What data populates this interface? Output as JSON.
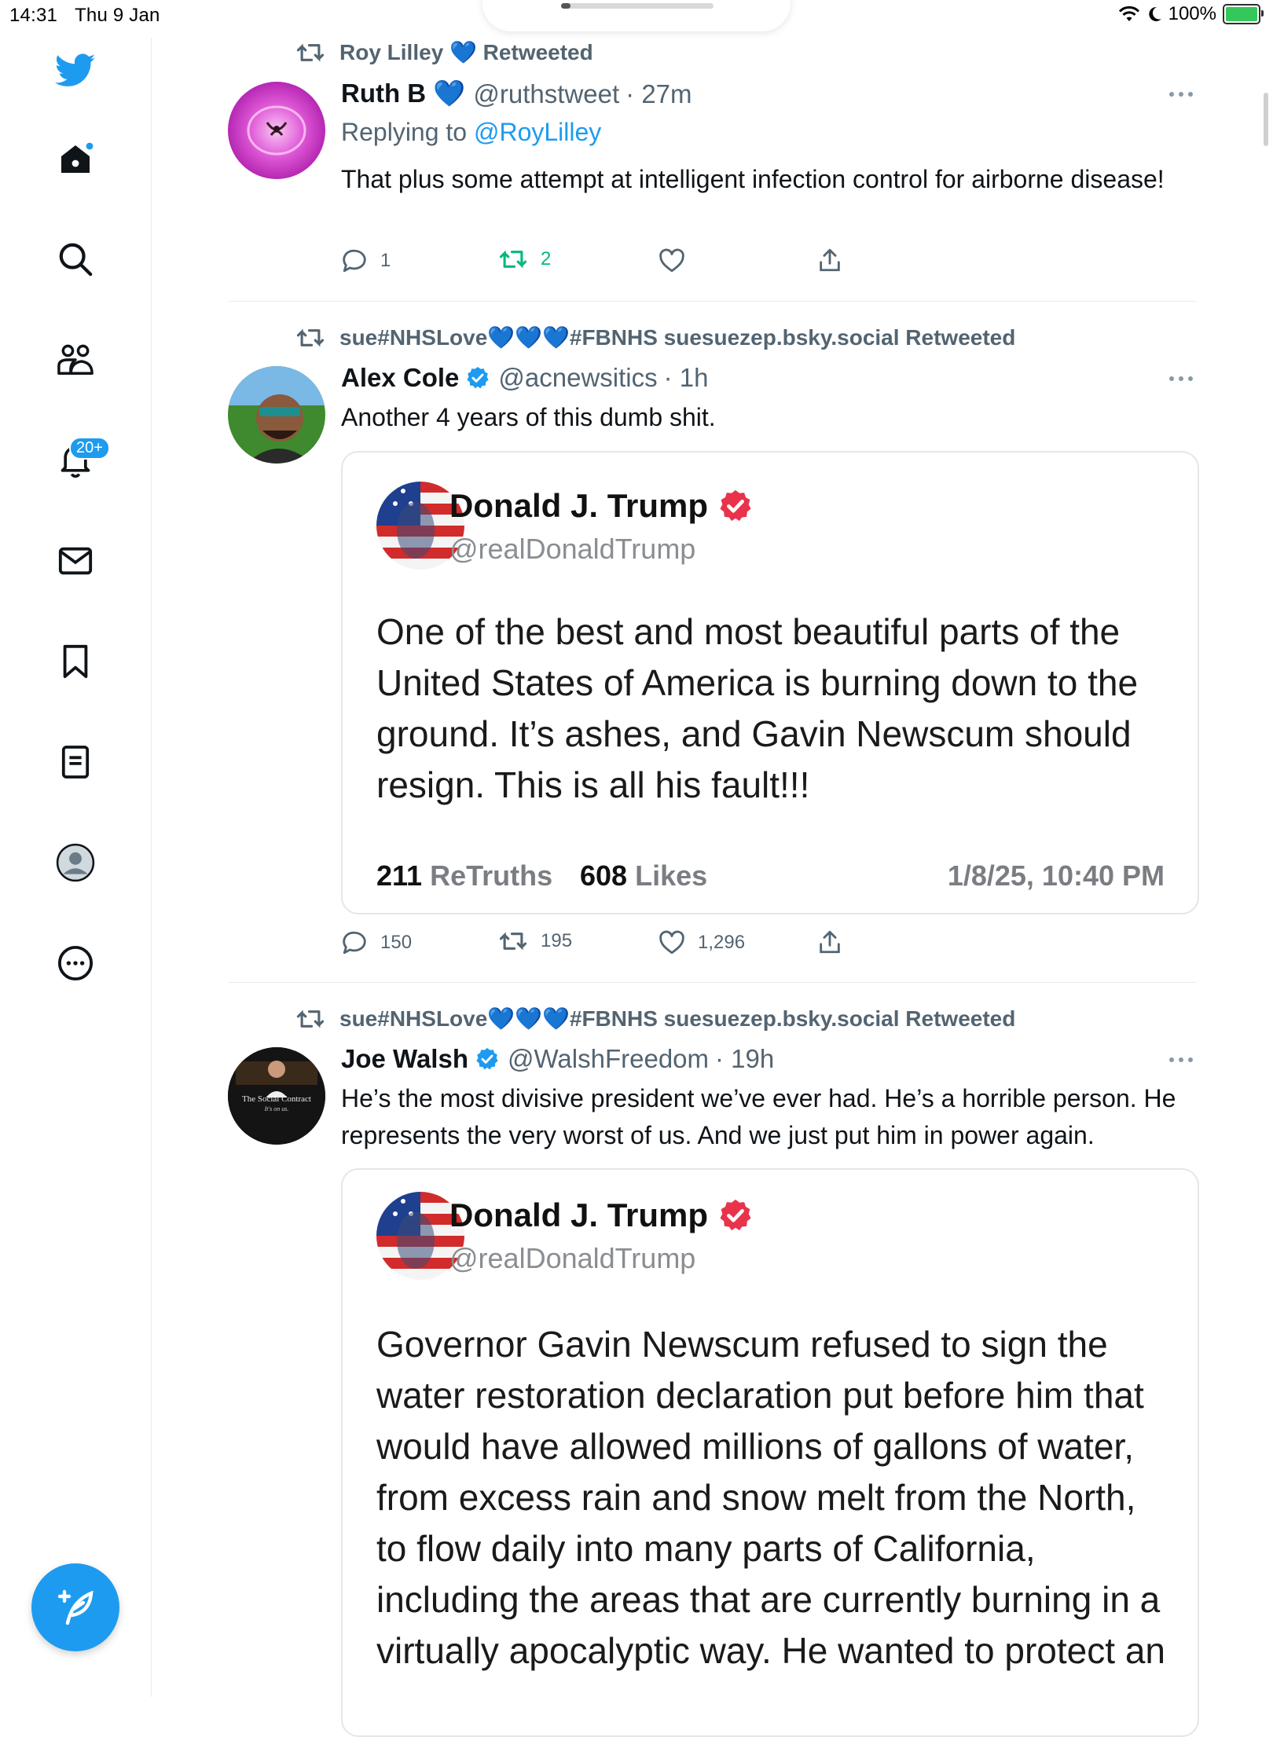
{
  "status_bar": {
    "time": "14:31",
    "date": "Thu 9 Jan",
    "battery": "100%"
  },
  "sidebar": {
    "notifications_badge": "20+",
    "items": [
      "home",
      "search",
      "communities",
      "notifications",
      "messages",
      "bookmarks",
      "lists",
      "profile",
      "more"
    ]
  },
  "tweets": [
    {
      "retweeted_by": "Roy Lilley 💙 Retweeted",
      "name": "Ruth B 💙",
      "handle": "@ruthstweet",
      "time": "· 27m",
      "replying_prefix": "Replying to",
      "replying_to": "@RoyLilley",
      "text": "That plus some attempt at intelligent infection control for airborne disease!",
      "replies": "1",
      "retweets": "2",
      "likes": ""
    },
    {
      "retweeted_by": "sue#NHSLove💙💙💙#FBNHS suesuezep.bsky.social Retweeted",
      "name": "Alex Cole",
      "handle": "@acnewsitics",
      "time": "· 1h",
      "text": "Another 4 years of this dumb shit.",
      "replies": "150",
      "retweets": "195",
      "likes": "1,296",
      "embed": {
        "name": "Donald J. Trump",
        "handle": "@realDonaldTrump",
        "text": "One of the best and most beautiful parts of the United States of America is burning down to the ground. It’s ashes, and Gavin Newscum should resign. This is all his fault!!!",
        "retruths_count": "211",
        "retruths_label": "ReTruths",
        "likes_count": "608",
        "likes_label": "Likes",
        "timestamp": "1/8/25, 10:40 PM"
      }
    },
    {
      "retweeted_by": "sue#NHSLove💙💙💙#FBNHS suesuezep.bsky.social Retweeted",
      "name": "Joe Walsh",
      "handle": "@WalshFreedom",
      "time": "· 19h",
      "avatar_caption_1": "The Social Contract",
      "avatar_caption_2": "It's on us.",
      "text": "He’s the most divisive president we’ve ever had. He’s a horrible person. He represents the very worst of us. And we just put him in power again.",
      "embed": {
        "name": "Donald J. Trump",
        "handle": "@realDonaldTrump",
        "text": "Governor Gavin Newscum refused to sign the water restoration declaration put before him that would have allowed millions of gallons of water, from excess rain and snow melt from the North, to flow daily into many parts of California, including the areas that are currently burning in a virtually apocalyptic way. He wanted to protect an"
      }
    }
  ],
  "colors": {
    "accent": "#1d9bf0",
    "retweet_green": "#00ba7c",
    "verified_red": "#e8334a"
  }
}
